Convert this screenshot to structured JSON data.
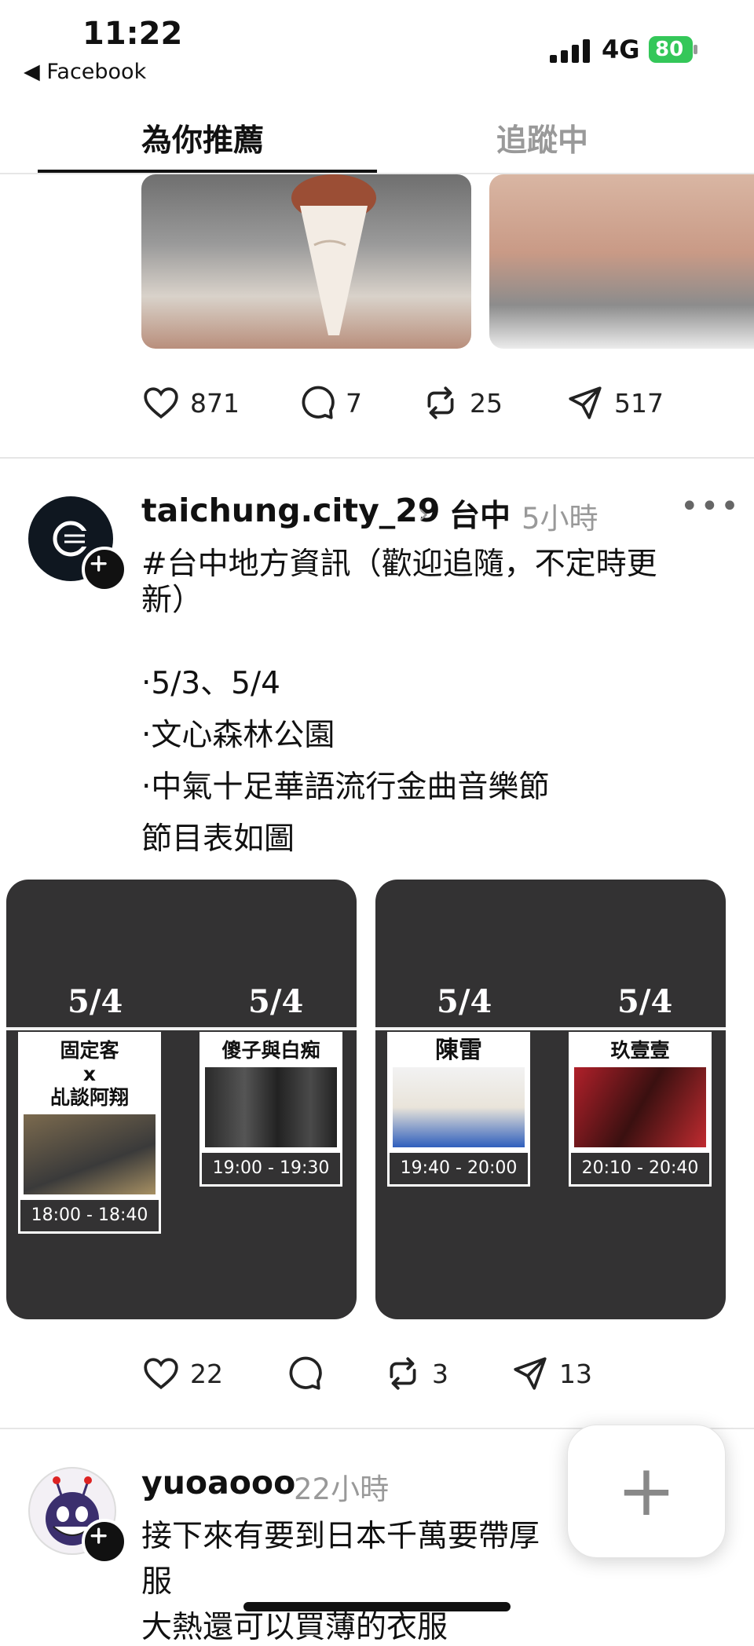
{
  "status_bar": {
    "time": "11:22",
    "back_app": "◀ Facebook",
    "network": "4G",
    "battery": "80"
  },
  "tabs": {
    "for_you": "為你推薦",
    "following": "追蹤中"
  },
  "post0": {
    "likes": "871",
    "replies": "7",
    "reposts": "25",
    "shares": "517"
  },
  "post1": {
    "username": "taichung.city_29",
    "place": "台中",
    "time": "5小時",
    "caption": "#台中地方資訊（歡迎追隨，不定時更新）",
    "lines": [
      "‧5/3、5/4",
      "‧文心森林公園",
      "‧中氣十足華語流行金曲音樂節",
      "節目表如圖"
    ],
    "schedule": [
      {
        "date": "5/4",
        "performer": "固定客\nx\n乩談阿翔",
        "time": "18:00 - 18:40"
      },
      {
        "date": "5/4",
        "performer": "傻子與白痴",
        "time": "19:00 - 19:30"
      },
      {
        "date": "5/4",
        "performer": "陳雷",
        "time": "19:40 - 20:00"
      },
      {
        "date": "5/4",
        "performer": "玖壹壹",
        "time": "20:10 - 20:40"
      }
    ],
    "likes": "22",
    "replies": "",
    "reposts": "3",
    "shares": "13"
  },
  "post2": {
    "username": "yuoaooo",
    "time": "22小時",
    "caption_lines": [
      "接下來有要到日本千萬要帶厚",
      "服",
      "大熱還可以買薄的衣服"
    ]
  },
  "icons": {
    "like": "heart-icon",
    "reply": "comment-icon",
    "repost": "repost-icon",
    "share": "send-icon",
    "more": "more-icon",
    "compose": "plus-icon"
  }
}
